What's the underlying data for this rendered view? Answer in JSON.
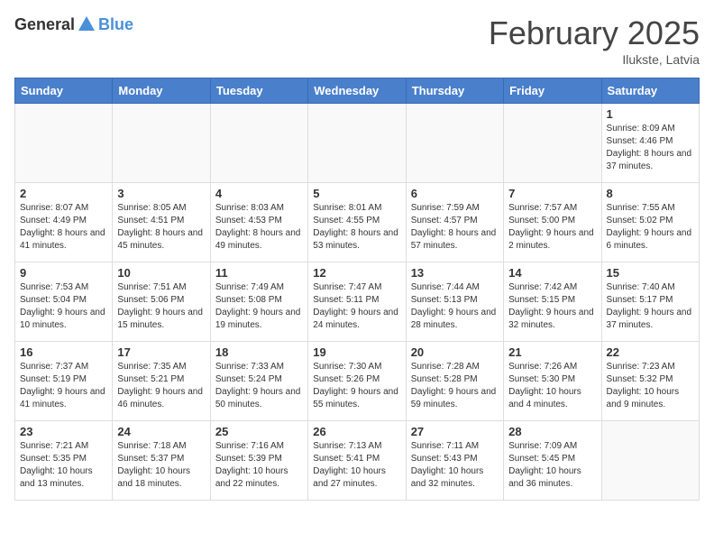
{
  "header": {
    "logo_general": "General",
    "logo_blue": "Blue",
    "month": "February 2025",
    "location": "Ilukste, Latvia"
  },
  "weekdays": [
    "Sunday",
    "Monday",
    "Tuesday",
    "Wednesday",
    "Thursday",
    "Friday",
    "Saturday"
  ],
  "weeks": [
    [
      {
        "day": "",
        "info": ""
      },
      {
        "day": "",
        "info": ""
      },
      {
        "day": "",
        "info": ""
      },
      {
        "day": "",
        "info": ""
      },
      {
        "day": "",
        "info": ""
      },
      {
        "day": "",
        "info": ""
      },
      {
        "day": "1",
        "info": "Sunrise: 8:09 AM\nSunset: 4:46 PM\nDaylight: 8 hours and 37 minutes."
      }
    ],
    [
      {
        "day": "2",
        "info": "Sunrise: 8:07 AM\nSunset: 4:49 PM\nDaylight: 8 hours and 41 minutes."
      },
      {
        "day": "3",
        "info": "Sunrise: 8:05 AM\nSunset: 4:51 PM\nDaylight: 8 hours and 45 minutes."
      },
      {
        "day": "4",
        "info": "Sunrise: 8:03 AM\nSunset: 4:53 PM\nDaylight: 8 hours and 49 minutes."
      },
      {
        "day": "5",
        "info": "Sunrise: 8:01 AM\nSunset: 4:55 PM\nDaylight: 8 hours and 53 minutes."
      },
      {
        "day": "6",
        "info": "Sunrise: 7:59 AM\nSunset: 4:57 PM\nDaylight: 8 hours and 57 minutes."
      },
      {
        "day": "7",
        "info": "Sunrise: 7:57 AM\nSunset: 5:00 PM\nDaylight: 9 hours and 2 minutes."
      },
      {
        "day": "8",
        "info": "Sunrise: 7:55 AM\nSunset: 5:02 PM\nDaylight: 9 hours and 6 minutes."
      }
    ],
    [
      {
        "day": "9",
        "info": "Sunrise: 7:53 AM\nSunset: 5:04 PM\nDaylight: 9 hours and 10 minutes."
      },
      {
        "day": "10",
        "info": "Sunrise: 7:51 AM\nSunset: 5:06 PM\nDaylight: 9 hours and 15 minutes."
      },
      {
        "day": "11",
        "info": "Sunrise: 7:49 AM\nSunset: 5:08 PM\nDaylight: 9 hours and 19 minutes."
      },
      {
        "day": "12",
        "info": "Sunrise: 7:47 AM\nSunset: 5:11 PM\nDaylight: 9 hours and 24 minutes."
      },
      {
        "day": "13",
        "info": "Sunrise: 7:44 AM\nSunset: 5:13 PM\nDaylight: 9 hours and 28 minutes."
      },
      {
        "day": "14",
        "info": "Sunrise: 7:42 AM\nSunset: 5:15 PM\nDaylight: 9 hours and 32 minutes."
      },
      {
        "day": "15",
        "info": "Sunrise: 7:40 AM\nSunset: 5:17 PM\nDaylight: 9 hours and 37 minutes."
      }
    ],
    [
      {
        "day": "16",
        "info": "Sunrise: 7:37 AM\nSunset: 5:19 PM\nDaylight: 9 hours and 41 minutes."
      },
      {
        "day": "17",
        "info": "Sunrise: 7:35 AM\nSunset: 5:21 PM\nDaylight: 9 hours and 46 minutes."
      },
      {
        "day": "18",
        "info": "Sunrise: 7:33 AM\nSunset: 5:24 PM\nDaylight: 9 hours and 50 minutes."
      },
      {
        "day": "19",
        "info": "Sunrise: 7:30 AM\nSunset: 5:26 PM\nDaylight: 9 hours and 55 minutes."
      },
      {
        "day": "20",
        "info": "Sunrise: 7:28 AM\nSunset: 5:28 PM\nDaylight: 9 hours and 59 minutes."
      },
      {
        "day": "21",
        "info": "Sunrise: 7:26 AM\nSunset: 5:30 PM\nDaylight: 10 hours and 4 minutes."
      },
      {
        "day": "22",
        "info": "Sunrise: 7:23 AM\nSunset: 5:32 PM\nDaylight: 10 hours and 9 minutes."
      }
    ],
    [
      {
        "day": "23",
        "info": "Sunrise: 7:21 AM\nSunset: 5:35 PM\nDaylight: 10 hours and 13 minutes."
      },
      {
        "day": "24",
        "info": "Sunrise: 7:18 AM\nSunset: 5:37 PM\nDaylight: 10 hours and 18 minutes."
      },
      {
        "day": "25",
        "info": "Sunrise: 7:16 AM\nSunset: 5:39 PM\nDaylight: 10 hours and 22 minutes."
      },
      {
        "day": "26",
        "info": "Sunrise: 7:13 AM\nSunset: 5:41 PM\nDaylight: 10 hours and 27 minutes."
      },
      {
        "day": "27",
        "info": "Sunrise: 7:11 AM\nSunset: 5:43 PM\nDaylight: 10 hours and 32 minutes."
      },
      {
        "day": "28",
        "info": "Sunrise: 7:09 AM\nSunset: 5:45 PM\nDaylight: 10 hours and 36 minutes."
      },
      {
        "day": "",
        "info": ""
      }
    ]
  ]
}
